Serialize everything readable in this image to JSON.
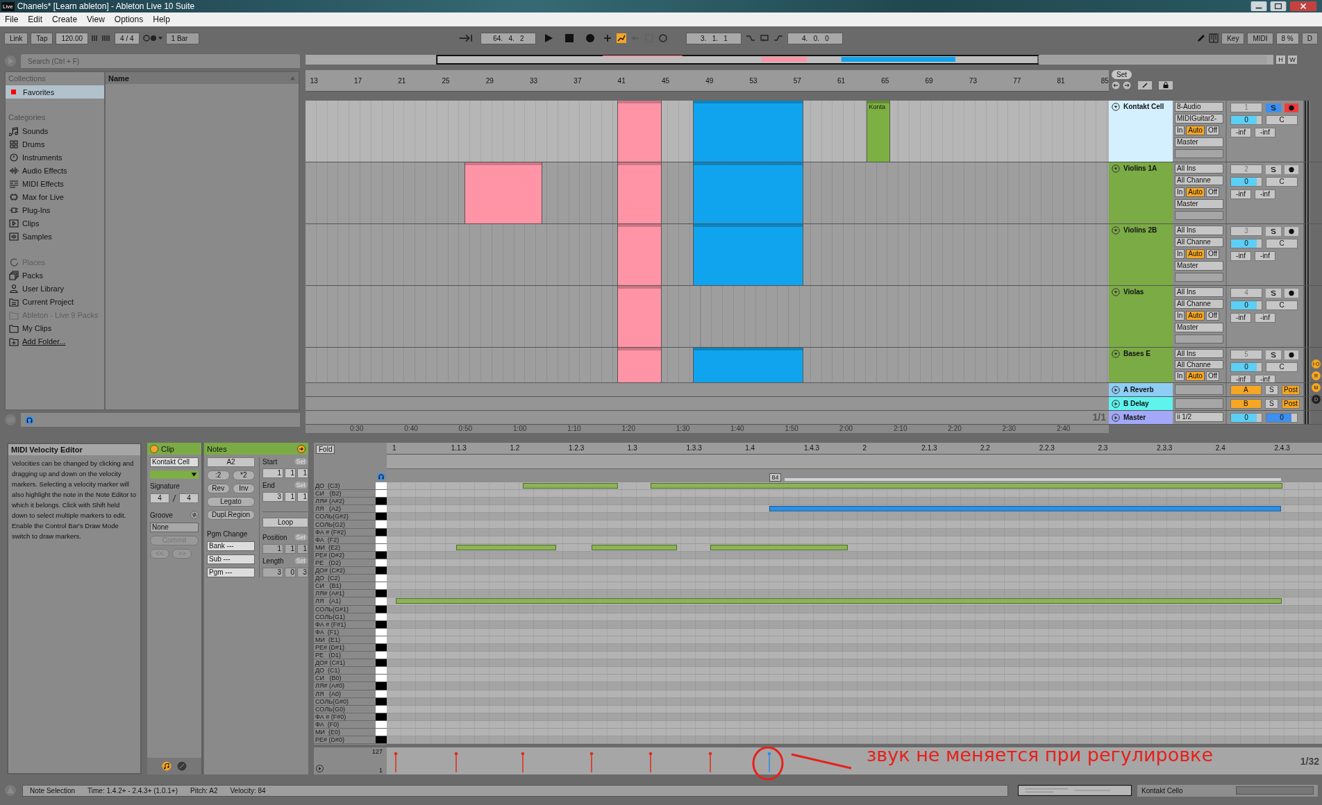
{
  "window": {
    "app_icon": "Live",
    "title": "Chanels*  [Learn ableton] - Ableton Live 10 Suite"
  },
  "menu": [
    "File",
    "Edit",
    "Create",
    "View",
    "Options",
    "Help"
  ],
  "control_bar": {
    "link": "Link",
    "tap": "Tap",
    "tempo": "120.00",
    "signature": "4 / 4",
    "quantize": "1 Bar",
    "position": "64.   4.   2",
    "automation_arm": true,
    "loop_start": "3.   1.   1",
    "loop_length": "4.   0.   0",
    "key": "Key",
    "midi": "MIDI",
    "cpu": "8 %",
    "disk": "D"
  },
  "browser": {
    "search_placeholder": "Search (Ctrl + F)",
    "collections_title": "Collections",
    "name_column": "Name",
    "collections": [
      {
        "label": "Favorites",
        "color": "#ff0000",
        "selected": true
      }
    ],
    "categories_title": "Categories",
    "categories": [
      {
        "label": "Sounds",
        "kind": "sounds"
      },
      {
        "label": "Drums",
        "kind": "drums"
      },
      {
        "label": "Instruments",
        "kind": "instruments"
      },
      {
        "label": "Audio Effects",
        "kind": "audio"
      },
      {
        "label": "MIDI Effects",
        "kind": "midi"
      },
      {
        "label": "Max for Live",
        "kind": "max"
      },
      {
        "label": "Plug-Ins",
        "kind": "plugin"
      },
      {
        "label": "Clips",
        "kind": "clips"
      },
      {
        "label": "Samples",
        "kind": "samples"
      }
    ],
    "places_title": "Places",
    "places": [
      {
        "label": "Packs",
        "kind": "packs",
        "disabled": false
      },
      {
        "label": "User Library",
        "kind": "user",
        "disabled": false
      },
      {
        "label": "Current Project",
        "kind": "project",
        "disabled": false
      },
      {
        "label": "Ableton - Live 9 Packs",
        "kind": "folder",
        "disabled": true
      },
      {
        "label": "My Clips",
        "kind": "folder",
        "disabled": false
      },
      {
        "label": "Add Folder...",
        "kind": "add",
        "disabled": false
      }
    ]
  },
  "arrangement": {
    "ruler": [
      "13",
      "17",
      "21",
      "25",
      "29",
      "33",
      "37",
      "41",
      "45",
      "49",
      "53",
      "57",
      "61",
      "65",
      "69",
      "73",
      "77",
      "81",
      "85"
    ],
    "overview_buttons": [
      "H",
      "W"
    ],
    "set_button": "Set",
    "zoom_label": "1/1",
    "time_ruler": [
      "0:30",
      "0:40",
      "0:50",
      "1:00",
      "1:10",
      "1:20",
      "1:30",
      "1:40",
      "1:50",
      "2:00",
      "2:10",
      "2:20",
      "2:30",
      "2:40"
    ],
    "tracks": [
      {
        "name": "Kontakt Cell",
        "selected": true,
        "input_type": "8-Audio",
        "input_channel": "MIDIGuitar2-",
        "monitor": [
          {
            "label": "In",
            "selected": false
          },
          {
            "label": "Auto",
            "selected": true
          },
          {
            "label": "Off",
            "selected": false
          }
        ],
        "output": "Master",
        "number": "1",
        "solo": true,
        "arm": true,
        "volume": "0",
        "level": 0.85,
        "pan": "C",
        "sends": [
          "-inf",
          "-inf"
        ],
        "clips": [
          {
            "color": "#ff94a6"
          },
          {
            "color": "#10a4ee"
          },
          {
            "color": "#7db042",
            "label": "Konta"
          }
        ]
      },
      {
        "name": "Violins 1A",
        "selected": false,
        "input_type": "All Ins",
        "input_channel": "All Channe",
        "monitor": [
          {
            "label": "In",
            "selected": false
          },
          {
            "label": "Auto",
            "selected": true
          },
          {
            "label": "Off",
            "selected": false
          }
        ],
        "output": "Master",
        "number": "2",
        "solo": false,
        "arm": false,
        "volume": "0",
        "level": 0.85,
        "pan": "C",
        "sends": [
          "-inf",
          "-inf"
        ],
        "clips": [
          {
            "color": "#ff94a6"
          },
          {
            "color": "#ff94a6"
          },
          {
            "color": "#10a4ee"
          }
        ]
      },
      {
        "name": "Violins 2B",
        "selected": false,
        "input_type": "All Ins",
        "input_channel": "All Channe",
        "monitor": [
          {
            "label": "In",
            "selected": false
          },
          {
            "label": "Auto",
            "selected": true
          },
          {
            "label": "Off",
            "selected": false
          }
        ],
        "output": "Master",
        "number": "3",
        "solo": false,
        "arm": false,
        "volume": "0",
        "level": 0.85,
        "pan": "C",
        "sends": [
          "-inf",
          "-inf"
        ],
        "clips": [
          {
            "color": "#ff94a6"
          },
          {
            "color": "#10a4ee"
          }
        ]
      },
      {
        "name": "Violas",
        "selected": false,
        "input_type": "All Ins",
        "input_channel": "All Channe",
        "monitor": [
          {
            "label": "In",
            "selected": false
          },
          {
            "label": "Auto",
            "selected": true
          },
          {
            "label": "Off",
            "selected": false
          }
        ],
        "output": "Master",
        "number": "4",
        "solo": false,
        "arm": false,
        "volume": "0",
        "level": 0.85,
        "pan": "C",
        "sends": [
          "-inf",
          "-inf"
        ],
        "clips": [
          {
            "color": "#ff94a6"
          }
        ]
      },
      {
        "name": "Bases E",
        "selected": false,
        "input_type": "All Ins",
        "input_channel": "All Channe",
        "monitor": [
          {
            "label": "In",
            "selected": false
          },
          {
            "label": "Auto",
            "selected": true
          },
          {
            "label": "Off",
            "selected": false
          }
        ],
        "number": "5",
        "solo": false,
        "arm": false,
        "volume": "0",
        "level": 0.85,
        "pan": "C",
        "sends": [
          "-inf",
          "-inf"
        ],
        "clips": [
          {
            "color": "#ff94a6"
          },
          {
            "color": "#10a4ee"
          }
        ]
      }
    ],
    "returns": [
      {
        "name": "A Reverb",
        "color": "#8fcdf5",
        "send": "A",
        "solo": "S",
        "post": "Post"
      },
      {
        "name": "B Delay",
        "color": "#5ff3ee",
        "send": "B",
        "solo": "S",
        "post": "Post"
      }
    ],
    "master": {
      "name": "Master",
      "color": "#a3a9f8",
      "output": "ii 1/2",
      "volume": "0",
      "level": 0.85,
      "cue": {
        "value": "0",
        "level": 0.82
      }
    },
    "side_buttons": [
      "I·O",
      "R",
      "M",
      "D"
    ]
  },
  "info": {
    "title": "MIDI Velocity Editor",
    "text": "Velocities can be changed by clicking and dragging up and down on the velocity markers. Selecting a velocity marker will also highlight the note in the Note Editor to which it belongs. Click with Shift held down to select multiple markers to edit. Enable the Control Bar's Draw Mode switch to draw markers."
  },
  "clip": {
    "title": "Clip",
    "name": "Kontakt Cell",
    "color": "#7db042",
    "signature_label": "Signature",
    "sig_num": "4",
    "sig_den": "4",
    "groove_label": "Groove",
    "groove": "None",
    "commit": "Commit",
    "prev": "<<",
    "next": ">>"
  },
  "notes": {
    "title": "Notes",
    "pitch": "A2",
    "half": ":2",
    "double": "*2",
    "rev": "Rev",
    "inv": "Inv",
    "legato": "Legato",
    "dupl": "Dupl.Region",
    "pgm_change": "Pgm Change",
    "bank": "Bank ---",
    "sub": "Sub ---",
    "pgm": "Pgm ---",
    "fields": [
      {
        "label": "Start",
        "set": "Set",
        "values": [
          "1",
          "1",
          "1"
        ]
      },
      {
        "label": "End",
        "set": "Set",
        "values": [
          "3",
          "1",
          "1"
        ]
      }
    ],
    "loop": "Loop",
    "loop_fields": [
      {
        "label": "Position",
        "set": "Set",
        "values": [
          "1",
          "1",
          "1"
        ]
      },
      {
        "label": "Length",
        "set": "Set",
        "values": [
          "3",
          "0",
          "3"
        ]
      }
    ]
  },
  "piano_roll": {
    "fold": "Fold",
    "ruler": [
      "1",
      "1.1.3",
      "1.2",
      "1.2.3",
      "1.3",
      "1.3.3",
      "1.4",
      "1.4.3",
      "2",
      "2.1.3",
      "2.2",
      "2.2.3",
      "2.3",
      "2.3.3",
      "2.4",
      "2.4.3"
    ],
    "velocity_label": "84",
    "velocity_max": "127",
    "velocity_min": "1",
    "grid": "1/32",
    "keys": [
      {
        "label": "ДО  (C3)",
        "black": false,
        "notes": [
          {
            "selected": false
          },
          {
            "selected": false
          }
        ]
      },
      {
        "label": "СИ   (B2)",
        "black": false
      },
      {
        "label": "ЛЯ# (A#2)",
        "black": true
      },
      {
        "label": "ЛЯ   (A2)",
        "black": false,
        "notes": [
          {
            "selected": true
          }
        ]
      },
      {
        "label": "СОЛЬ(G#2)",
        "black": true
      },
      {
        "label": "СОЛЬ(G2)",
        "black": false
      },
      {
        "label": "ФА # (F#2)",
        "black": true
      },
      {
        "label": "ФА  (F2)",
        "black": false
      },
      {
        "label": "МИ  (E2)",
        "black": false,
        "notes": [
          {
            "selected": false
          },
          {
            "selected": false
          },
          {
            "selected": false
          }
        ]
      },
      {
        "label": "РЕ# (D#2)",
        "black": true
      },
      {
        "label": "РЕ   (D2)",
        "black": false
      },
      {
        "label": "ДО# (C#2)",
        "black": true
      },
      {
        "label": "ДО  (C2)",
        "black": false
      },
      {
        "label": "СИ   (B1)",
        "black": false
      },
      {
        "label": "ЛЯ# (A#1)",
        "black": true
      },
      {
        "label": "ЛЯ   (A1)",
        "black": false,
        "notes": [
          {
            "selected": false
          }
        ]
      },
      {
        "label": "СОЛЬ(G#1)",
        "black": true
      },
      {
        "label": "СОЛЬ(G1)",
        "black": false
      },
      {
        "label": "ФА # (F#1)",
        "black": true
      },
      {
        "label": "ФА  (F1)",
        "black": false
      },
      {
        "label": "МИ  (E1)",
        "black": false
      },
      {
        "label": "РЕ# (D#1)",
        "black": true
      },
      {
        "label": "РЕ   (D1)",
        "black": false
      },
      {
        "label": "ДО# (C#1)",
        "black": true
      },
      {
        "label": "ДО  (C1)",
        "black": false
      },
      {
        "label": "СИ   (B0)",
        "black": false
      },
      {
        "label": "ЛЯ# (A#0)",
        "black": true
      },
      {
        "label": "ЛЯ   (A0)",
        "black": false
      },
      {
        "label": "СОЛЬ(G#0)",
        "black": true
      },
      {
        "label": "СОЛЬ(G0)",
        "black": false
      },
      {
        "label": "ФА # (F#0)",
        "black": true
      },
      {
        "label": "ФА  (F0)",
        "black": false
      },
      {
        "label": "МИ  (E0)",
        "black": false
      },
      {
        "label": "РЕ# (D#0)",
        "black": true
      }
    ]
  },
  "annotation": {
    "text": "звук не меняется при регулировке"
  },
  "status_bar": {
    "mode": "Note Selection",
    "time": "Time: 1.4.2+ - 2.4.3+ (1.0.1+)",
    "pitch": "Pitch: A2",
    "velocity": "Velocity: 84",
    "track": "Kontakt Cello"
  }
}
